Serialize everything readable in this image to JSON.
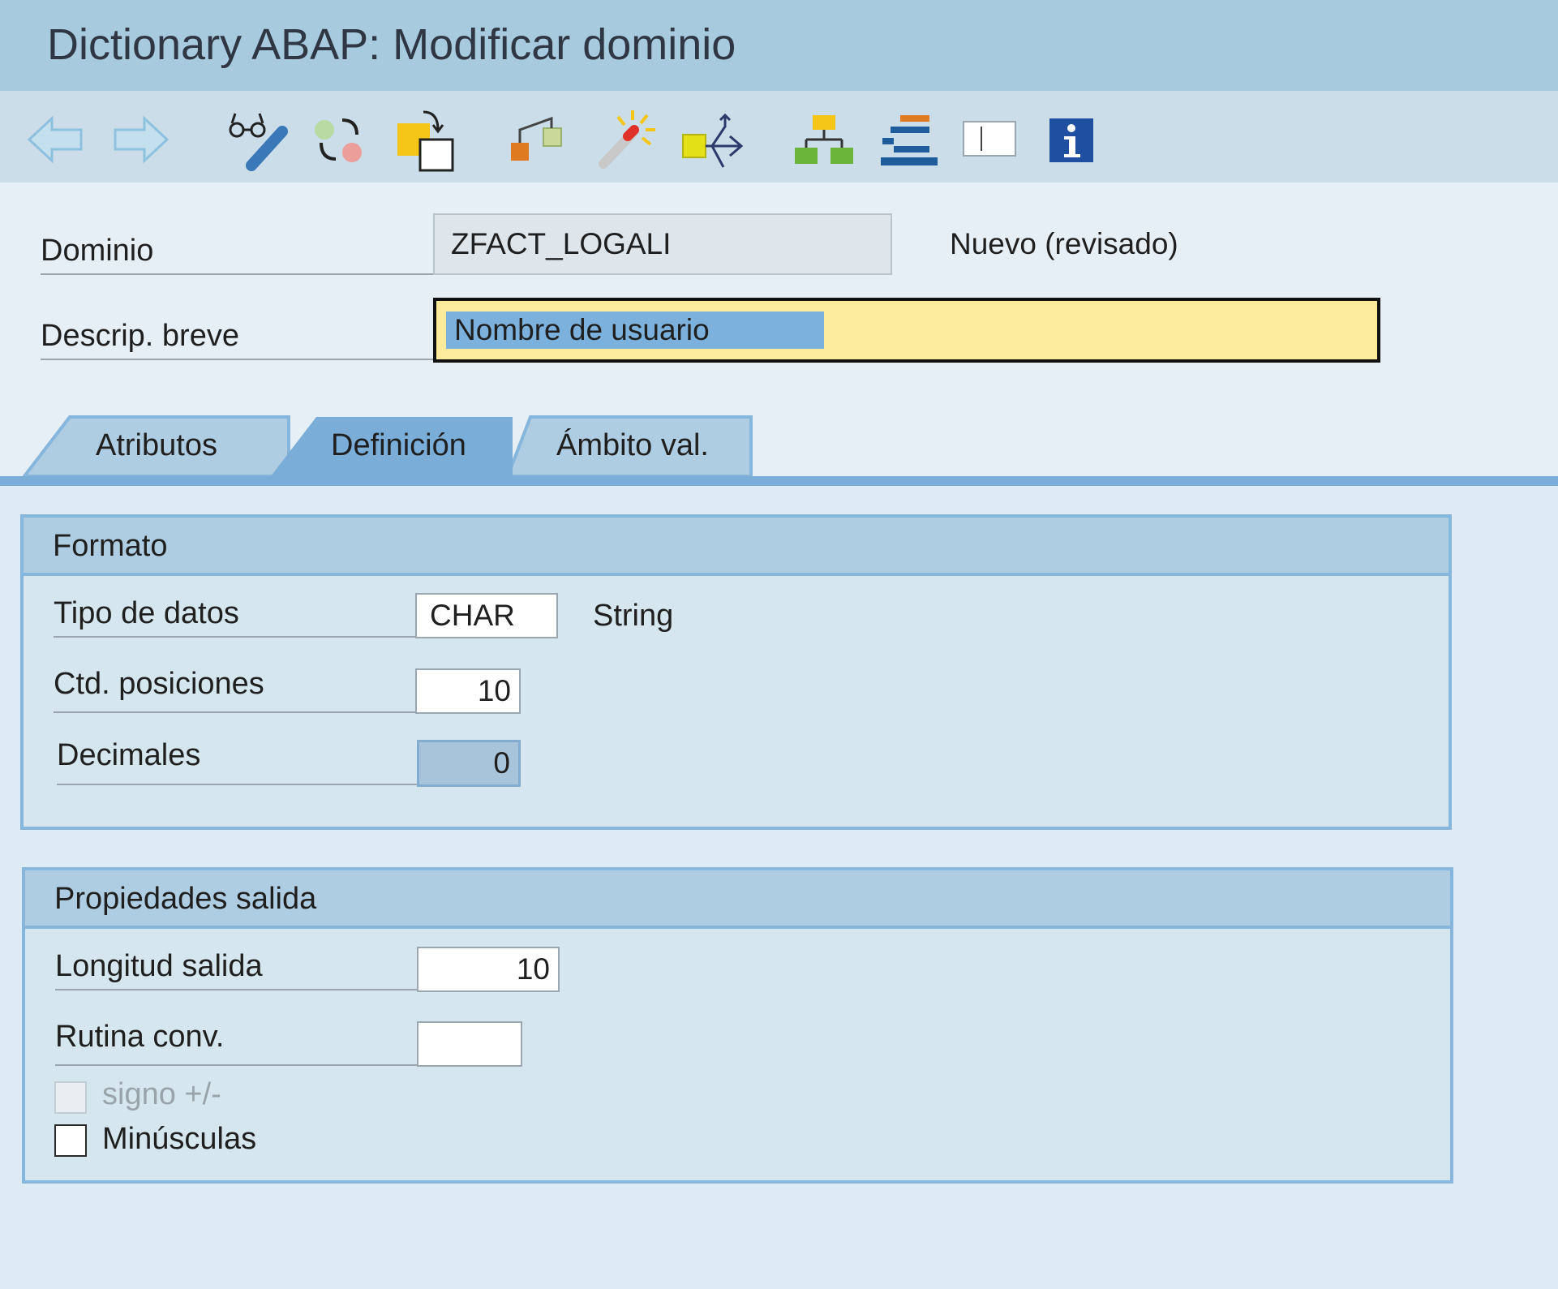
{
  "window": {
    "title": "Dictionary ABAP: Modificar dominio"
  },
  "toolbar": {
    "icons": [
      "back-arrow-icon",
      "forward-arrow-icon",
      "display-change-icon",
      "active-inactive-icon",
      "other-object-icon",
      "activate-icon",
      "where-used-icon",
      "object-list-icon",
      "navigation-window-icon",
      "layout-icon",
      "info-icon"
    ]
  },
  "header": {
    "domain_label": "Dominio",
    "domain_value": "ZFACT_LOGALI",
    "status": "Nuevo (revisado)",
    "short_desc_label": "Descrip. breve",
    "short_desc_value": "Nombre de usuario"
  },
  "tabs": [
    {
      "label": "Atributos",
      "active": false
    },
    {
      "label": "Definición",
      "active": true
    },
    {
      "label": "Ámbito val.",
      "active": false
    }
  ],
  "formato": {
    "title": "Formato",
    "data_type_label": "Tipo de datos",
    "data_type_value": "CHAR",
    "data_type_desc": "String",
    "length_label": "Ctd. posiciones",
    "length_value": "10",
    "decimals_label": "Decimales",
    "decimals_value": "0"
  },
  "output": {
    "title": "Propiedades salida",
    "output_length_label": "Longitud salida",
    "output_length_value": "10",
    "conv_routine_label": "Rutina conv.",
    "conv_routine_value": "",
    "sign_label": "signo +/-",
    "sign_checked": false,
    "lowercase_label": "Minúsculas",
    "lowercase_checked": false
  },
  "colors": {
    "titlebar": "#a8cade",
    "toolbar": "#cadde8",
    "active_tab": "#7aaed9",
    "required_field": "#fdeb9c",
    "selection": "#7bb1dc"
  }
}
